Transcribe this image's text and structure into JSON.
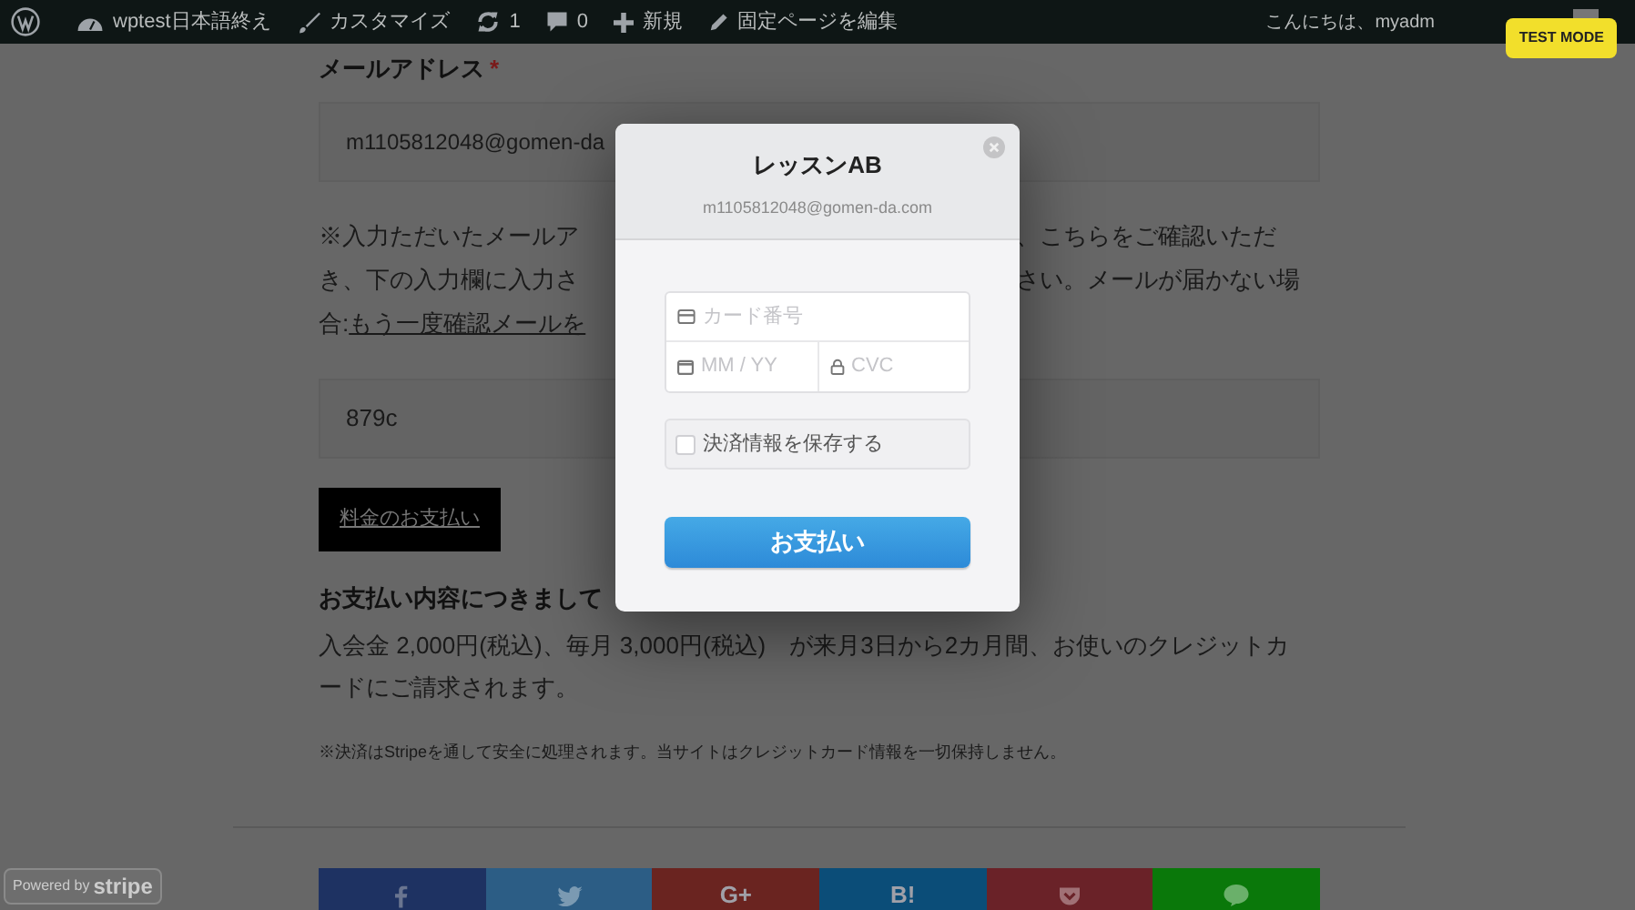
{
  "admin_bar": {
    "items": [
      {
        "kind": "logo"
      },
      {
        "kind": "site",
        "label": "wptest日本語終え"
      },
      {
        "kind": "customize",
        "label": "カスタマイズ"
      },
      {
        "kind": "updates",
        "label": "1"
      },
      {
        "kind": "comments",
        "label": "0"
      },
      {
        "kind": "new",
        "label": "新規"
      },
      {
        "kind": "edit",
        "label": "固定ページを編集"
      }
    ],
    "greeting": "こんにちは、myadm"
  },
  "test_mode_badge": "TEST MODE",
  "form": {
    "email_label": "メールアドレス",
    "required_mark": "*",
    "email_value": "m1105812048@gomen-da",
    "notice_lines": [
      {
        "left": [
          {
            "text": "※入力ただいたメールア"
          }
        ],
        "right": "、こちらをご確認いただ"
      },
      {
        "left": [
          {
            "text": "き、下の入力欄に入力さ"
          }
        ],
        "right": "さい。メールが届かない場"
      },
      {
        "left": [
          {
            "text": "合:"
          },
          {
            "text": "もう一度確認メールを",
            "kind": "link"
          }
        ]
      }
    ],
    "code_value": "879c",
    "pay_button": "料金のお支払い",
    "details_heading": "お支払い内容につきまして",
    "details_text": "入会金 2,000円(税込)、毎月 3,000円(税込)　が来月3日から2カ月間、お使いのクレジットカードにご請求されます。",
    "security_note": "※決済はStripeを通して安全に処理されます。当サイトはクレジットカード情報を一切保持しません。"
  },
  "share_buttons": [
    {
      "kind": "facebook",
      "color": "#1e3262"
    },
    {
      "kind": "twitter",
      "color": "#2c5d85"
    },
    {
      "kind": "googleplus",
      "label": "G+",
      "color": "#6a2420"
    },
    {
      "kind": "hatena",
      "label": "B!",
      "color": "#0b4d78"
    },
    {
      "kind": "pocket",
      "color": "#6a2228"
    },
    {
      "kind": "line",
      "color": "#0a780a"
    }
  ],
  "stripe_badge": {
    "powered": "Powered by",
    "brand": "stripe"
  },
  "checkout": {
    "title": "レッスンAB",
    "email": "m1105812048@gomen-da.com",
    "card_placeholder": "カード番号",
    "expiry_placeholder": "MM / YY",
    "cvc_placeholder": "CVC",
    "remember": {
      "label": "決済情報を保存する",
      "checked": false
    },
    "pay_button": "お支払い"
  }
}
